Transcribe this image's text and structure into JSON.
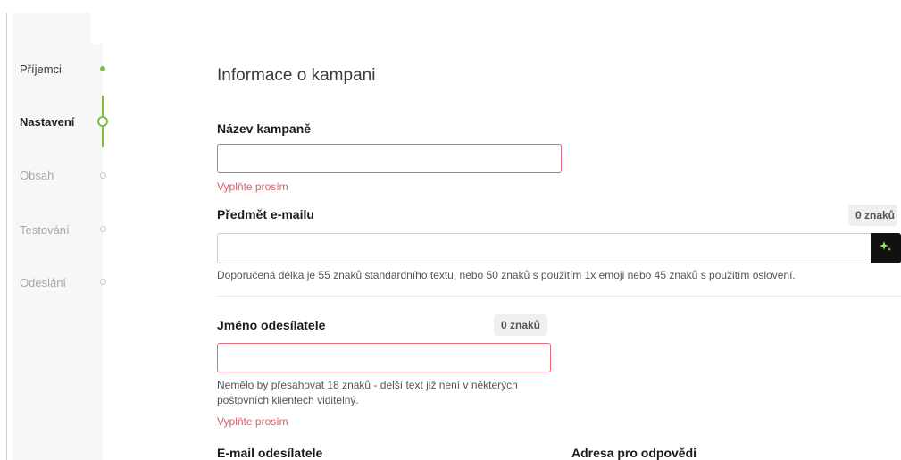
{
  "stepper": {
    "steps": [
      {
        "label": "Příjemci",
        "state": "done"
      },
      {
        "label": "Nastavení",
        "state": "active"
      },
      {
        "label": "Obsah",
        "state": "future"
      },
      {
        "label": "Testování",
        "state": "future"
      },
      {
        "label": "Odeslání",
        "state": "future"
      }
    ],
    "accent_color": "#7cc043"
  },
  "main": {
    "title": "Informace o kampani",
    "campaign_name": {
      "label": "Název kampaně",
      "value": "",
      "error": "Vyplňte prosím"
    },
    "subject": {
      "label": "Předmět e-mailu",
      "counter": "0 znaků",
      "value": "",
      "hint": "Doporučená délka je 55 znaků standardního textu, nebo 50 znaků s použitím 1x emoji nebo 45 znaků s použitím oslovení.",
      "ai_icon": "sparkle-icon"
    },
    "sender_name": {
      "label": "Jméno odesílatele",
      "counter": "0 znaků",
      "value": "",
      "hint_line1": "Nemělo by přesahovat 18 znaků - delší text již není v některých",
      "hint_line2": "poštovních klientech viditelný.",
      "error": "Vyplňte prosím"
    },
    "sender_email": {
      "label": "E-mail odesílatele"
    },
    "reply_to": {
      "label": "Adresa pro odpovědi"
    }
  },
  "colors": {
    "error": "#e05a6c",
    "accent": "#7cc043"
  }
}
